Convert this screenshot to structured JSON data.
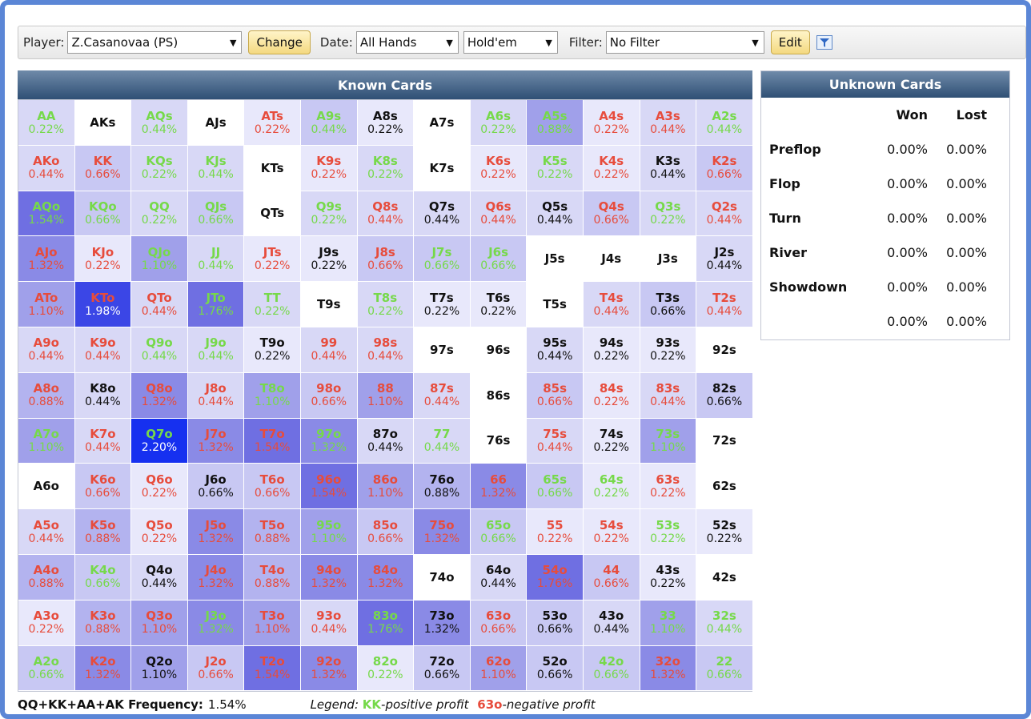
{
  "toolbar": {
    "player_label": "Player:",
    "player_value": "Z.Casanovaa (PS)",
    "change_label": "Change",
    "date_label": "Date:",
    "date_value": "All Hands",
    "game_value": "Hold'em",
    "filter_label": "Filter:",
    "filter_value": "No Filter",
    "edit_label": "Edit"
  },
  "known": {
    "title": "Known Cards",
    "rows": [
      [
        [
          "AA",
          "0.22%",
          "G",
          "L2"
        ],
        [
          "AKs",
          "",
          "K",
          "W"
        ],
        [
          "AQs",
          "0.44%",
          "G",
          "L2"
        ],
        [
          "AJs",
          "",
          "K",
          "W"
        ],
        [
          "ATs",
          "0.22%",
          "R",
          "L1"
        ],
        [
          "A9s",
          "0.44%",
          "G",
          "L3"
        ],
        [
          "A8s",
          "0.22%",
          "K",
          "L1"
        ],
        [
          "A7s",
          "",
          "K",
          "W"
        ],
        [
          "A6s",
          "0.22%",
          "G",
          "L2"
        ],
        [
          "A5s",
          "0.88%",
          "G",
          "L5"
        ],
        [
          "A4s",
          "0.22%",
          "R",
          "L1"
        ],
        [
          "A3s",
          "0.44%",
          "R",
          "L2"
        ],
        [
          "A2s",
          "0.44%",
          "G",
          "L2"
        ]
      ],
      [
        [
          "AKo",
          "0.44%",
          "R",
          "L2"
        ],
        [
          "KK",
          "0.66%",
          "R",
          "L3"
        ],
        [
          "KQs",
          "0.22%",
          "G",
          "L2"
        ],
        [
          "KJs",
          "0.44%",
          "G",
          "L2"
        ],
        [
          "KTs",
          "",
          "K",
          "W"
        ],
        [
          "K9s",
          "0.22%",
          "R",
          "L1"
        ],
        [
          "K8s",
          "0.22%",
          "G",
          "L2"
        ],
        [
          "K7s",
          "",
          "K",
          "W"
        ],
        [
          "K6s",
          "0.22%",
          "R",
          "L1"
        ],
        [
          "K5s",
          "0.22%",
          "G",
          "L2"
        ],
        [
          "K4s",
          "0.22%",
          "R",
          "L1"
        ],
        [
          "K3s",
          "0.44%",
          "K",
          "L2"
        ],
        [
          "K2s",
          "0.66%",
          "R",
          "L3"
        ]
      ],
      [
        [
          "AQo",
          "1.54%",
          "G",
          "L7"
        ],
        [
          "KQo",
          "0.66%",
          "G",
          "L3"
        ],
        [
          "QQ",
          "0.22%",
          "G",
          "L2"
        ],
        [
          "QJs",
          "0.66%",
          "G",
          "L3"
        ],
        [
          "QTs",
          "",
          "K",
          "W"
        ],
        [
          "Q9s",
          "0.22%",
          "G",
          "L2"
        ],
        [
          "Q8s",
          "0.44%",
          "R",
          "L2"
        ],
        [
          "Q7s",
          "0.44%",
          "K",
          "L2"
        ],
        [
          "Q6s",
          "0.44%",
          "R",
          "L2"
        ],
        [
          "Q5s",
          "0.44%",
          "K",
          "L2"
        ],
        [
          "Q4s",
          "0.66%",
          "R",
          "L3"
        ],
        [
          "Q3s",
          "0.22%",
          "G",
          "L2"
        ],
        [
          "Q2s",
          "0.44%",
          "R",
          "L2"
        ]
      ],
      [
        [
          "AJo",
          "1.32%",
          "R",
          "L6"
        ],
        [
          "KJo",
          "0.22%",
          "R",
          "L1"
        ],
        [
          "QJo",
          "1.10%",
          "G",
          "L5"
        ],
        [
          "JJ",
          "0.44%",
          "G",
          "L2"
        ],
        [
          "JTs",
          "0.22%",
          "R",
          "L1"
        ],
        [
          "J9s",
          "0.22%",
          "K",
          "L1"
        ],
        [
          "J8s",
          "0.66%",
          "R",
          "L3"
        ],
        [
          "J7s",
          "0.66%",
          "G",
          "L3"
        ],
        [
          "J6s",
          "0.66%",
          "G",
          "L3"
        ],
        [
          "J5s",
          "",
          "K",
          "W"
        ],
        [
          "J4s",
          "",
          "K",
          "W"
        ],
        [
          "J3s",
          "",
          "K",
          "W"
        ],
        [
          "J2s",
          "0.44%",
          "K",
          "L2"
        ]
      ],
      [
        [
          "ATo",
          "1.10%",
          "R",
          "L5"
        ],
        [
          "KTo",
          "1.98%",
          "R",
          "L8"
        ],
        [
          "QTo",
          "0.44%",
          "R",
          "L2"
        ],
        [
          "JTo",
          "1.76%",
          "G",
          "L7"
        ],
        [
          "TT",
          "0.22%",
          "G",
          "L2"
        ],
        [
          "T9s",
          "",
          "K",
          "W"
        ],
        [
          "T8s",
          "0.22%",
          "G",
          "L2"
        ],
        [
          "T7s",
          "0.22%",
          "K",
          "L1"
        ],
        [
          "T6s",
          "0.22%",
          "K",
          "L1"
        ],
        [
          "T5s",
          "",
          "K",
          "W"
        ],
        [
          "T4s",
          "0.44%",
          "R",
          "L2"
        ],
        [
          "T3s",
          "0.66%",
          "K",
          "L3"
        ],
        [
          "T2s",
          "0.44%",
          "R",
          "L2"
        ]
      ],
      [
        [
          "A9o",
          "0.44%",
          "R",
          "L2"
        ],
        [
          "K9o",
          "0.44%",
          "R",
          "L2"
        ],
        [
          "Q9o",
          "0.44%",
          "G",
          "L2"
        ],
        [
          "J9o",
          "0.44%",
          "G",
          "L2"
        ],
        [
          "T9o",
          "0.22%",
          "K",
          "L1"
        ],
        [
          "99",
          "0.44%",
          "R",
          "L2"
        ],
        [
          "98s",
          "0.44%",
          "R",
          "L2"
        ],
        [
          "97s",
          "",
          "K",
          "W"
        ],
        [
          "96s",
          "",
          "K",
          "W"
        ],
        [
          "95s",
          "0.44%",
          "K",
          "L2"
        ],
        [
          "94s",
          "0.22%",
          "K",
          "L1"
        ],
        [
          "93s",
          "0.22%",
          "K",
          "L1"
        ],
        [
          "92s",
          "",
          "K",
          "W"
        ]
      ],
      [
        [
          "A8o",
          "0.88%",
          "R",
          "L4"
        ],
        [
          "K8o",
          "0.44%",
          "K",
          "L2"
        ],
        [
          "Q8o",
          "1.32%",
          "R",
          "L6"
        ],
        [
          "J8o",
          "0.44%",
          "R",
          "L2"
        ],
        [
          "T8o",
          "1.10%",
          "G",
          "L5"
        ],
        [
          "98o",
          "0.66%",
          "R",
          "L3"
        ],
        [
          "88",
          "1.10%",
          "R",
          "L5"
        ],
        [
          "87s",
          "0.44%",
          "R",
          "L2"
        ],
        [
          "86s",
          "",
          "K",
          "W"
        ],
        [
          "85s",
          "0.66%",
          "R",
          "L3"
        ],
        [
          "84s",
          "0.22%",
          "R",
          "L1"
        ],
        [
          "83s",
          "0.44%",
          "R",
          "L2"
        ],
        [
          "82s",
          "0.66%",
          "K",
          "L3"
        ]
      ],
      [
        [
          "A7o",
          "1.10%",
          "G",
          "L5"
        ],
        [
          "K7o",
          "0.44%",
          "R",
          "L2"
        ],
        [
          "Q7o",
          "2.20%",
          "G",
          "L9"
        ],
        [
          "J7o",
          "1.32%",
          "R",
          "L6"
        ],
        [
          "T7o",
          "1.54%",
          "R",
          "L7"
        ],
        [
          "97o",
          "1.32%",
          "G",
          "L6"
        ],
        [
          "87o",
          "0.44%",
          "K",
          "L2"
        ],
        [
          "77",
          "0.44%",
          "G",
          "L2"
        ],
        [
          "76s",
          "",
          "K",
          "W"
        ],
        [
          "75s",
          "0.44%",
          "R",
          "L2"
        ],
        [
          "74s",
          "0.22%",
          "K",
          "L1"
        ],
        [
          "73s",
          "1.10%",
          "G",
          "L5"
        ],
        [
          "72s",
          "",
          "K",
          "W"
        ]
      ],
      [
        [
          "A6o",
          "",
          "K",
          "W"
        ],
        [
          "K6o",
          "0.66%",
          "R",
          "L3"
        ],
        [
          "Q6o",
          "0.22%",
          "R",
          "L1"
        ],
        [
          "J6o",
          "0.66%",
          "K",
          "L3"
        ],
        [
          "T6o",
          "0.66%",
          "R",
          "L3"
        ],
        [
          "96o",
          "1.54%",
          "R",
          "L7"
        ],
        [
          "86o",
          "1.10%",
          "R",
          "L5"
        ],
        [
          "76o",
          "0.88%",
          "K",
          "L4"
        ],
        [
          "66",
          "1.32%",
          "R",
          "L6"
        ],
        [
          "65s",
          "0.66%",
          "G",
          "L3"
        ],
        [
          "64s",
          "0.22%",
          "G",
          "L1"
        ],
        [
          "63s",
          "0.22%",
          "R",
          "L1"
        ],
        [
          "62s",
          "",
          "K",
          "W"
        ]
      ],
      [
        [
          "A5o",
          "0.44%",
          "R",
          "L2"
        ],
        [
          "K5o",
          "0.88%",
          "R",
          "L4"
        ],
        [
          "Q5o",
          "0.22%",
          "R",
          "L1"
        ],
        [
          "J5o",
          "1.32%",
          "R",
          "L6"
        ],
        [
          "T5o",
          "0.88%",
          "R",
          "L4"
        ],
        [
          "95o",
          "1.10%",
          "G",
          "L5"
        ],
        [
          "85o",
          "0.66%",
          "R",
          "L3"
        ],
        [
          "75o",
          "1.32%",
          "R",
          "L6"
        ],
        [
          "65o",
          "0.66%",
          "G",
          "L3"
        ],
        [
          "55",
          "0.22%",
          "R",
          "L1"
        ],
        [
          "54s",
          "0.22%",
          "R",
          "L1"
        ],
        [
          "53s",
          "0.22%",
          "G",
          "L1"
        ],
        [
          "52s",
          "0.22%",
          "K",
          "L1"
        ]
      ],
      [
        [
          "A4o",
          "0.88%",
          "R",
          "L4"
        ],
        [
          "K4o",
          "0.66%",
          "G",
          "L3"
        ],
        [
          "Q4o",
          "0.44%",
          "K",
          "L2"
        ],
        [
          "J4o",
          "1.32%",
          "R",
          "L6"
        ],
        [
          "T4o",
          "0.88%",
          "R",
          "L4"
        ],
        [
          "94o",
          "1.32%",
          "R",
          "L6"
        ],
        [
          "84o",
          "1.32%",
          "R",
          "L6"
        ],
        [
          "74o",
          "",
          "K",
          "W"
        ],
        [
          "64o",
          "0.44%",
          "K",
          "L2"
        ],
        [
          "54o",
          "1.76%",
          "R",
          "L7"
        ],
        [
          "44",
          "0.66%",
          "R",
          "L3"
        ],
        [
          "43s",
          "0.22%",
          "K",
          "L1"
        ],
        [
          "42s",
          "",
          "K",
          "W"
        ]
      ],
      [
        [
          "A3o",
          "0.22%",
          "R",
          "L1"
        ],
        [
          "K3o",
          "0.88%",
          "R",
          "L4"
        ],
        [
          "Q3o",
          "1.10%",
          "R",
          "L5"
        ],
        [
          "J3o",
          "1.32%",
          "G",
          "L6"
        ],
        [
          "T3o",
          "1.10%",
          "R",
          "L5"
        ],
        [
          "93o",
          "0.44%",
          "R",
          "L2"
        ],
        [
          "83o",
          "1.76%",
          "G",
          "L7"
        ],
        [
          "73o",
          "1.32%",
          "K",
          "L6"
        ],
        [
          "63o",
          "0.66%",
          "R",
          "L3"
        ],
        [
          "53o",
          "0.66%",
          "K",
          "L3"
        ],
        [
          "43o",
          "0.44%",
          "K",
          "L2"
        ],
        [
          "33",
          "1.10%",
          "G",
          "L5"
        ],
        [
          "32s",
          "0.44%",
          "G",
          "L2"
        ]
      ],
      [
        [
          "A2o",
          "0.66%",
          "G",
          "L3"
        ],
        [
          "K2o",
          "1.32%",
          "R",
          "L6"
        ],
        [
          "Q2o",
          "1.10%",
          "K",
          "L5"
        ],
        [
          "J2o",
          "0.66%",
          "R",
          "L3"
        ],
        [
          "T2o",
          "1.54%",
          "R",
          "L7"
        ],
        [
          "92o",
          "1.32%",
          "R",
          "L6"
        ],
        [
          "82o",
          "0.22%",
          "G",
          "L1"
        ],
        [
          "72o",
          "0.66%",
          "K",
          "L3"
        ],
        [
          "62o",
          "1.10%",
          "R",
          "L5"
        ],
        [
          "52o",
          "0.66%",
          "K",
          "L3"
        ],
        [
          "42o",
          "0.66%",
          "G",
          "L3"
        ],
        [
          "32o",
          "1.32%",
          "R",
          "L6"
        ],
        [
          "22",
          "0.66%",
          "G",
          "L3"
        ]
      ]
    ]
  },
  "colors": {
    "positive": "#76d94a",
    "negative": "#e74c3c",
    "neutral": "#111111",
    "levels": {
      "W": "#ffffff",
      "L1": "#e8e8fb",
      "L2": "#d8d8f6",
      "L3": "#c8c8f3",
      "L4": "#b3b3ef",
      "L5": "#a0a0ea",
      "L6": "#8a8ae6",
      "L7": "#6f6fe2",
      "L8": "#3b46e6",
      "L9": "#1630f0"
    }
  },
  "footer": {
    "freq_label": "QQ+KK+AA+AK Frequency:",
    "freq_value": "1.54%",
    "legend_label": "Legend:",
    "legend_pos_hand": "KK",
    "legend_pos_text": "-positive profit",
    "legend_neg_hand": "63o",
    "legend_neg_text": "-negative profit"
  },
  "unknown": {
    "title": "Unknown Cards",
    "col_won": "Won",
    "col_lost": "Lost",
    "rows": [
      {
        "label": "Preflop",
        "won": "0.00%",
        "lost": "0.00%"
      },
      {
        "label": "Flop",
        "won": "0.00%",
        "lost": "0.00%"
      },
      {
        "label": "Turn",
        "won": "0.00%",
        "lost": "0.00%"
      },
      {
        "label": "River",
        "won": "0.00%",
        "lost": "0.00%"
      },
      {
        "label": "Showdown",
        "won": "0.00%",
        "lost": "0.00%"
      },
      {
        "label": "",
        "won": "0.00%",
        "lost": "0.00%"
      }
    ]
  }
}
